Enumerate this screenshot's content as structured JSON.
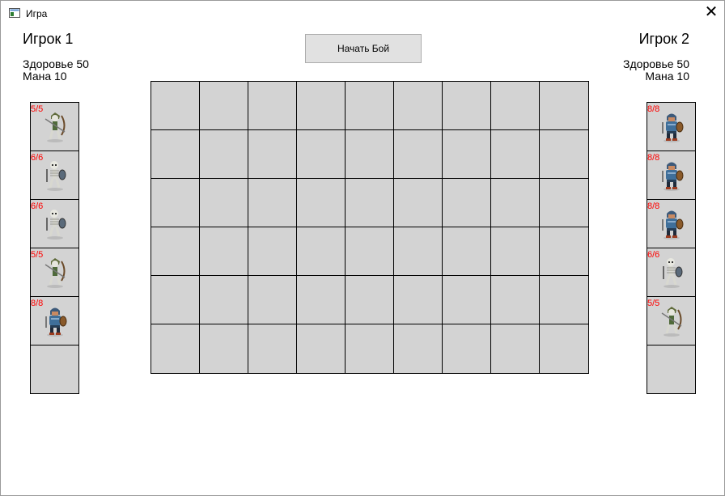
{
  "window": {
    "title": "Игра",
    "close_icon": "close-icon"
  },
  "player1": {
    "name": "Игрок 1",
    "health_label": "Здоровье 50",
    "mana_label": "Мана 10"
  },
  "player2": {
    "name": "Игрок 2",
    "health_label": "Здоровье 50",
    "mana_label": "Мана 10"
  },
  "start_button": {
    "label": "Начать Бой"
  },
  "board": {
    "columns": 9,
    "rows": 6
  },
  "hand1": [
    {
      "hp": "5/5",
      "unit": "skeleton-archer"
    },
    {
      "hp": "6/6",
      "unit": "skeleton-warrior"
    },
    {
      "hp": "6/6",
      "unit": "skeleton-warrior"
    },
    {
      "hp": "5/5",
      "unit": "skeleton-archer"
    },
    {
      "hp": "8/8",
      "unit": "armored-knight"
    },
    {
      "hp": "",
      "unit": ""
    }
  ],
  "hand2": [
    {
      "hp": "8/8",
      "unit": "armored-knight"
    },
    {
      "hp": "8/8",
      "unit": "armored-knight"
    },
    {
      "hp": "8/8",
      "unit": "armored-knight"
    },
    {
      "hp": "6/6",
      "unit": "skeleton-warrior"
    },
    {
      "hp": "5/5",
      "unit": "skeleton-archer"
    },
    {
      "hp": "",
      "unit": ""
    }
  ],
  "colors": {
    "cell": "#d3d3d3",
    "hp_text": "#ff0000",
    "grid_line": "#000000"
  }
}
